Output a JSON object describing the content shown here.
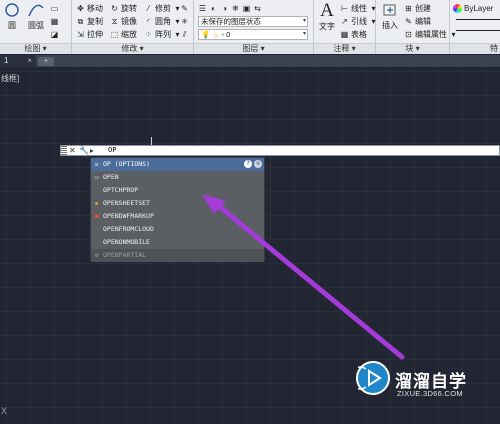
{
  "ribbon": {
    "draw_panel": {
      "title": "绘图 ▾",
      "circle_label": "圆",
      "arc_label": "圆弧"
    },
    "modify_panel": {
      "title": "修改 ▾",
      "rows": [
        [
          "移动",
          "旋转",
          "修剪"
        ],
        [
          "复制",
          "镜像",
          "圆角"
        ],
        [
          "拉伸",
          "缩放",
          "阵列"
        ]
      ]
    },
    "layers_panel": {
      "title": "图层 ▾",
      "layer_state": "未保存的图层状态",
      "layer_current": "0"
    },
    "annotation_panel": {
      "title": "注释 ▾",
      "text_label": "文字",
      "rows": [
        "线性",
        "引线",
        "表格"
      ]
    },
    "block_panel": {
      "title": "块 ▾",
      "insert_label": "插入",
      "rows": [
        "创建",
        "编辑",
        "编辑属性"
      ]
    },
    "properties_panel": {
      "bylayer": "ByLayer",
      "title_fragment": "特"
    }
  },
  "tabs": {
    "file_tab": "1",
    "close": "×"
  },
  "viewport_label": "线框]",
  "command_line": {
    "prompt_icon": "▸",
    "input_value": "OP"
  },
  "autocomplete": {
    "items": [
      "OP (OPTIONS)",
      "OPEN",
      "OPTCHPROP",
      "OPENSHEETSET",
      "OPENDWFMARKUP",
      "OPENFROMCLOUD",
      "OPENONMOBILE",
      "OPENPARTIAL"
    ],
    "help_icon": "?",
    "globe_icon": "⊕"
  },
  "ucs_icon": "X",
  "watermark": {
    "text": "溜溜自学",
    "url": "ZIXUE.3D66.COM"
  },
  "colors": {
    "canvas": "#212632",
    "arrow": "#a43bd8",
    "highlight": "#4b6d9b"
  }
}
